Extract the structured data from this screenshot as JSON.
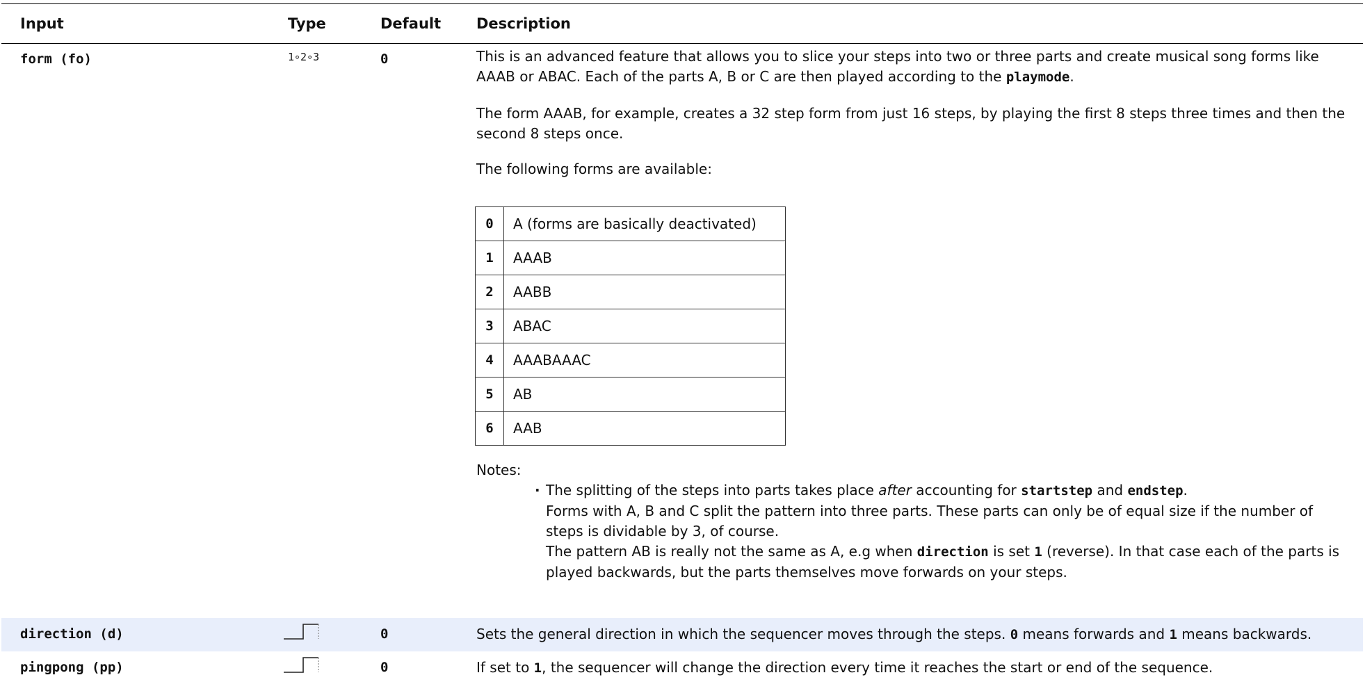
{
  "header": {
    "input": "Input",
    "type": "Type",
    "default": "Default",
    "description": "Description"
  },
  "form_row": {
    "input": "form (fo)",
    "type": "1∘2∘3",
    "default": "0",
    "p1_a": "This is an advanced feature that allows you to slice your steps into two or three parts and create musical song forms like AAAB or ABAC. Each of the parts A, B or C are then played according to the ",
    "p1_code": "playmode",
    "p1_b": ".",
    "p2": "The form AAAB, for example, creates a 32 step form from just 16 steps, by playing the first 8 steps three times and then the second 8 steps once.",
    "p3": "The following forms are available:",
    "forms": [
      {
        "key": "0",
        "value": "A (forms are basically deactivated)"
      },
      {
        "key": "1",
        "value": "AAAB"
      },
      {
        "key": "2",
        "value": "AABB"
      },
      {
        "key": "3",
        "value": "ABAC"
      },
      {
        "key": "4",
        "value": "AAABAAAC"
      },
      {
        "key": "5",
        "value": "AB"
      },
      {
        "key": "6",
        "value": "AAB"
      }
    ],
    "notes_label": "Notes:",
    "note1_a": "The splitting of the steps into parts takes place ",
    "note1_em": "after",
    "note1_b": " accounting for ",
    "note1_code1": "startstep",
    "note1_c": " and ",
    "note1_code2": "endstep",
    "note1_d": ".",
    "note2": "Forms with A, B and C split the pattern into three parts.  These parts can only be of equal size if the number of steps is dividable by 3, of course.",
    "note3_a": "The pattern AB is really not the same as A, e.g when ",
    "note3_code1": "direction",
    "note3_b": " is set ",
    "note3_code2": "1",
    "note3_c": " (reverse). In that case each of the parts is played backwards, but the parts themselves move forwards on your steps."
  },
  "direction_row": {
    "input": "direction (d)",
    "type_icon": "gate-icon",
    "default": "0",
    "desc_a": "Sets the general direction in which the sequencer moves through the steps. ",
    "desc_code1": "0",
    "desc_b": " means forwards and ",
    "desc_code2": "1",
    "desc_c": " means backwards."
  },
  "pingpong_row": {
    "input": "pingpong (pp)",
    "type_icon": "gate-icon",
    "default": "0",
    "desc_a": "If set to ",
    "desc_code1": "1",
    "desc_b": ", the sequencer will change the direction every time it reaches the start or end of the sequence."
  },
  "colors": {
    "alt_row_bg": "#e8eefb",
    "border": "#333333"
  }
}
